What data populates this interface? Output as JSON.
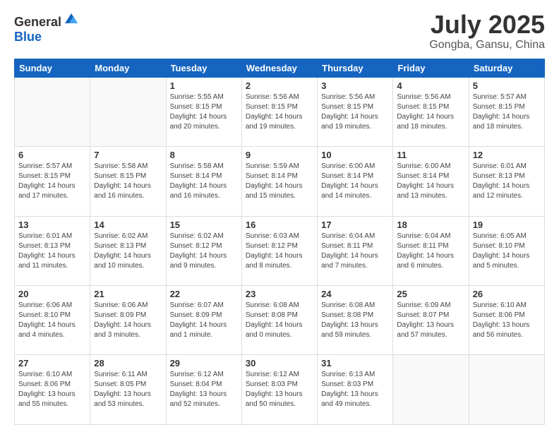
{
  "header": {
    "logo_general": "General",
    "logo_blue": "Blue",
    "title": "July 2025",
    "subtitle": "Gongba, Gansu, China"
  },
  "days_of_week": [
    "Sunday",
    "Monday",
    "Tuesday",
    "Wednesday",
    "Thursday",
    "Friday",
    "Saturday"
  ],
  "weeks": [
    [
      {
        "day": "",
        "info": ""
      },
      {
        "day": "",
        "info": ""
      },
      {
        "day": "1",
        "info": "Sunrise: 5:55 AM\nSunset: 8:15 PM\nDaylight: 14 hours and 20 minutes."
      },
      {
        "day": "2",
        "info": "Sunrise: 5:56 AM\nSunset: 8:15 PM\nDaylight: 14 hours and 19 minutes."
      },
      {
        "day": "3",
        "info": "Sunrise: 5:56 AM\nSunset: 8:15 PM\nDaylight: 14 hours and 19 minutes."
      },
      {
        "day": "4",
        "info": "Sunrise: 5:56 AM\nSunset: 8:15 PM\nDaylight: 14 hours and 18 minutes."
      },
      {
        "day": "5",
        "info": "Sunrise: 5:57 AM\nSunset: 8:15 PM\nDaylight: 14 hours and 18 minutes."
      }
    ],
    [
      {
        "day": "6",
        "info": "Sunrise: 5:57 AM\nSunset: 8:15 PM\nDaylight: 14 hours and 17 minutes."
      },
      {
        "day": "7",
        "info": "Sunrise: 5:58 AM\nSunset: 8:15 PM\nDaylight: 14 hours and 16 minutes."
      },
      {
        "day": "8",
        "info": "Sunrise: 5:58 AM\nSunset: 8:14 PM\nDaylight: 14 hours and 16 minutes."
      },
      {
        "day": "9",
        "info": "Sunrise: 5:59 AM\nSunset: 8:14 PM\nDaylight: 14 hours and 15 minutes."
      },
      {
        "day": "10",
        "info": "Sunrise: 6:00 AM\nSunset: 8:14 PM\nDaylight: 14 hours and 14 minutes."
      },
      {
        "day": "11",
        "info": "Sunrise: 6:00 AM\nSunset: 8:14 PM\nDaylight: 14 hours and 13 minutes."
      },
      {
        "day": "12",
        "info": "Sunrise: 6:01 AM\nSunset: 8:13 PM\nDaylight: 14 hours and 12 minutes."
      }
    ],
    [
      {
        "day": "13",
        "info": "Sunrise: 6:01 AM\nSunset: 8:13 PM\nDaylight: 14 hours and 11 minutes."
      },
      {
        "day": "14",
        "info": "Sunrise: 6:02 AM\nSunset: 8:13 PM\nDaylight: 14 hours and 10 minutes."
      },
      {
        "day": "15",
        "info": "Sunrise: 6:02 AM\nSunset: 8:12 PM\nDaylight: 14 hours and 9 minutes."
      },
      {
        "day": "16",
        "info": "Sunrise: 6:03 AM\nSunset: 8:12 PM\nDaylight: 14 hours and 8 minutes."
      },
      {
        "day": "17",
        "info": "Sunrise: 6:04 AM\nSunset: 8:11 PM\nDaylight: 14 hours and 7 minutes."
      },
      {
        "day": "18",
        "info": "Sunrise: 6:04 AM\nSunset: 8:11 PM\nDaylight: 14 hours and 6 minutes."
      },
      {
        "day": "19",
        "info": "Sunrise: 6:05 AM\nSunset: 8:10 PM\nDaylight: 14 hours and 5 minutes."
      }
    ],
    [
      {
        "day": "20",
        "info": "Sunrise: 6:06 AM\nSunset: 8:10 PM\nDaylight: 14 hours and 4 minutes."
      },
      {
        "day": "21",
        "info": "Sunrise: 6:06 AM\nSunset: 8:09 PM\nDaylight: 14 hours and 3 minutes."
      },
      {
        "day": "22",
        "info": "Sunrise: 6:07 AM\nSunset: 8:09 PM\nDaylight: 14 hours and 1 minute."
      },
      {
        "day": "23",
        "info": "Sunrise: 6:08 AM\nSunset: 8:08 PM\nDaylight: 14 hours and 0 minutes."
      },
      {
        "day": "24",
        "info": "Sunrise: 6:08 AM\nSunset: 8:08 PM\nDaylight: 13 hours and 59 minutes."
      },
      {
        "day": "25",
        "info": "Sunrise: 6:09 AM\nSunset: 8:07 PM\nDaylight: 13 hours and 57 minutes."
      },
      {
        "day": "26",
        "info": "Sunrise: 6:10 AM\nSunset: 8:06 PM\nDaylight: 13 hours and 56 minutes."
      }
    ],
    [
      {
        "day": "27",
        "info": "Sunrise: 6:10 AM\nSunset: 8:06 PM\nDaylight: 13 hours and 55 minutes."
      },
      {
        "day": "28",
        "info": "Sunrise: 6:11 AM\nSunset: 8:05 PM\nDaylight: 13 hours and 53 minutes."
      },
      {
        "day": "29",
        "info": "Sunrise: 6:12 AM\nSunset: 8:04 PM\nDaylight: 13 hours and 52 minutes."
      },
      {
        "day": "30",
        "info": "Sunrise: 6:12 AM\nSunset: 8:03 PM\nDaylight: 13 hours and 50 minutes."
      },
      {
        "day": "31",
        "info": "Sunrise: 6:13 AM\nSunset: 8:03 PM\nDaylight: 13 hours and 49 minutes."
      },
      {
        "day": "",
        "info": ""
      },
      {
        "day": "",
        "info": ""
      }
    ]
  ]
}
